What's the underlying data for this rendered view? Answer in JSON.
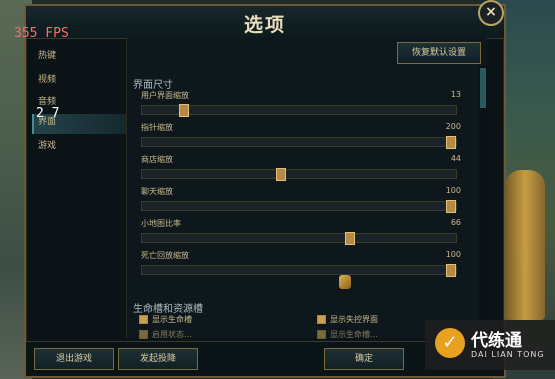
{
  "window": {
    "title": "选项",
    "fps": "355 FPS",
    "close_glyph": "×"
  },
  "sidebar": {
    "items": [
      {
        "label": "热键"
      },
      {
        "label": "视频"
      },
      {
        "label": "音频"
      },
      {
        "label": "界面"
      },
      {
        "label": "游戏"
      }
    ],
    "active_index": 3,
    "overlay_text": "2 7"
  },
  "content": {
    "reset_label": "恢复默认设置",
    "section1": "界面尺寸",
    "sliders": [
      {
        "label": "用户界面缩放",
        "value": 13
      },
      {
        "label": "指针缩放",
        "value": 200
      },
      {
        "label": "商店缩放",
        "value": 44
      },
      {
        "label": "聊天缩放",
        "value": 100
      },
      {
        "label": "小地图比率",
        "value": 66
      },
      {
        "label": "死亡回放缩放",
        "value": 100
      }
    ],
    "section2": "生命槽和资源槽",
    "checkboxes": [
      {
        "label": "显示生命槽"
      },
      {
        "label": "显示失控界面"
      },
      {
        "label": "启用状态..."
      },
      {
        "label": "显示生命槽..."
      }
    ]
  },
  "footer": {
    "quit_label": "退出游戏",
    "surrender_label": "发起投降",
    "confirm_label": "确定"
  },
  "watermark": {
    "cn": "代练通",
    "en": "DAI LIAN TONG",
    "logo": "✓"
  },
  "colors": {
    "accent_gold": "#b48a44",
    "bg_dark": "#0b1317",
    "fps_red": "#ff6a6a"
  }
}
